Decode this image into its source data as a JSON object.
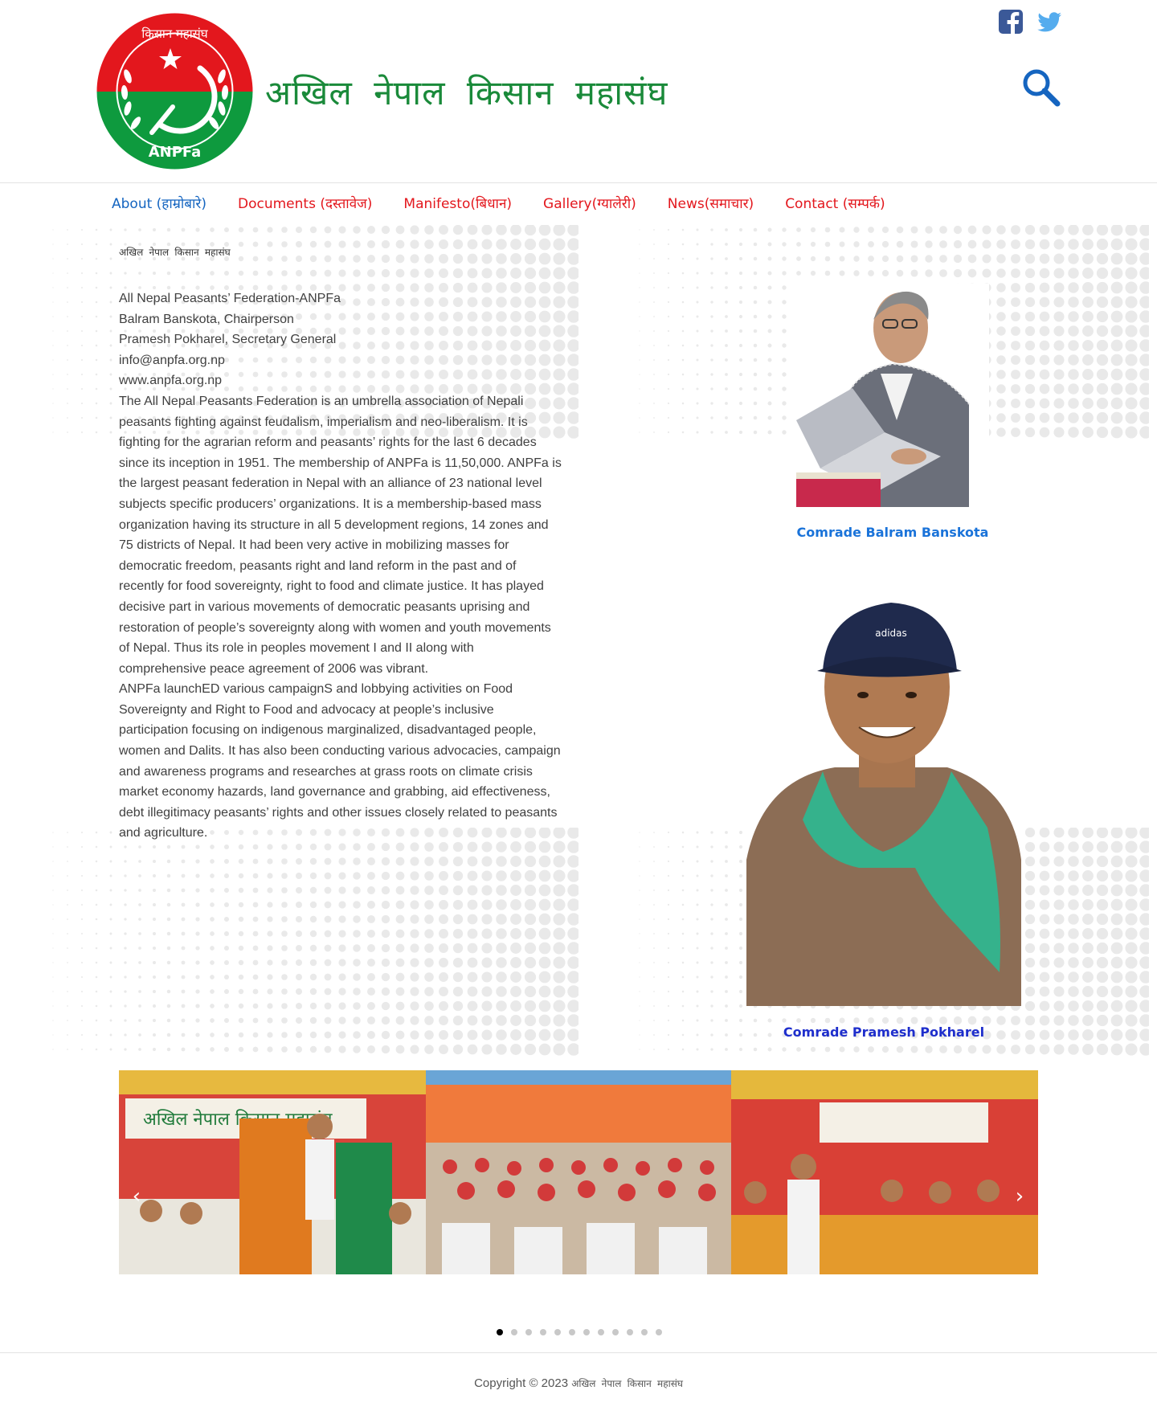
{
  "header": {
    "site_title": "अखिल नेपाल किसान महासंघ",
    "logo": {
      "top_text": "किसान महासंघ",
      "bottom_text": "ANPFa",
      "colors": {
        "top": "#e3171d",
        "bottom": "#0e9a3e",
        "ring": "#ffffff"
      }
    },
    "social": [
      {
        "icon": "facebook-icon",
        "color": "#3b5998"
      },
      {
        "icon": "twitter-icon",
        "color": "#55acee"
      }
    ],
    "search_icon": "search-icon",
    "search_color": "#1565c0"
  },
  "nav": {
    "items": [
      {
        "label": "About (हाम्रोबारे)",
        "color": "#1565c0"
      },
      {
        "label": "Documents (दस्तावेज)",
        "color": "#e3171d"
      },
      {
        "label": "Manifesto(बिधान)",
        "color": "#e3171d"
      },
      {
        "label": "Gallery(ग्यालेरी)",
        "color": "#e3171d"
      },
      {
        "label": "News(समाचार)",
        "color": "#e3171d"
      },
      {
        "label": "Contact (सम्पर्क)",
        "color": "#e3171d"
      }
    ]
  },
  "intro": {
    "title": "अखिल नेपाल किसान महासंघ",
    "lines": [
      "All Nepal Peasants’ Federation-ANPFa",
      "Balram Banskota, Chairperson",
      "Pramesh Pokharel, Secretary General",
      "info@anpfa.org.np",
      "www.anpfa.org.np"
    ],
    "paragraph_1": "The All Nepal Peasants Federation is an umbrella association of Nepali peasants fighting against feudalism, imperialism and neo-liberalism. It is fighting for the agrarian reform and peasants’ rights for the last 6 decades since its inception in 1951. The membership of ANPFa is 11,50,000. ANPFa is the largest peasant federation in Nepal with an alliance of 23 national level subjects specific producers’ organizations. It is a membership-based mass organization having its structure in all 5 development regions, 14 zones and 75 districts of Nepal. It had been very active in mobilizing masses for democratic freedom, peasants right and land reform in the past and of recently for food sovereignty, right to food and climate justice. It has played decisive part in various movements of democratic peasants uprising and restoration of people’s sovereignty along with women and youth movements of Nepal. Thus its role in peoples movement I and II along with comprehensive peace agreement of 2006 was vibrant.",
    "paragraph_2": "ANPFa launchED various campaignS and lobbying activities on Food Sovereignty and Right to Food and advocacy at people’s inclusive participation focusing on indigenous marginalized, disadvantaged people, women and Dalits. It has also been conducting various advocacies, campaign and awareness programs and researches at grass roots on climate crisis market economy hazards, land governance and grabbing, aid effectiveness, debt illegitimacy peasants’ rights and other issues closely related to peasants and agriculture."
  },
  "people": [
    {
      "caption": "Comrade Balram Banskota",
      "color": "#1a73d9"
    },
    {
      "caption": "Comrade Pramesh Pokharel",
      "color": "#1e2ecc"
    }
  ],
  "slider": {
    "banner_text": "अखिल नेपाल किसान महासंघ",
    "prev_icon": "‹",
    "next_icon": "›",
    "page_count": 12,
    "active_page": 1
  },
  "footer": {
    "copyright": "Copyright © 2023 ",
    "brand": "अखिल नेपाल किसान महासंघ"
  }
}
